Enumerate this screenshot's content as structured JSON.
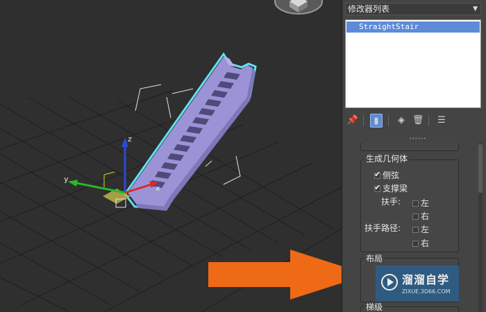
{
  "panel": {
    "modifier_dropdown": "修改器列表",
    "stack_items": [
      "StraightStair"
    ],
    "scroll_position": 0.05
  },
  "geometry_group": {
    "title": "生成几何体",
    "stringers": {
      "label": "侧弦",
      "checked": true
    },
    "carriage": {
      "label": "支撑梁",
      "checked": true
    },
    "handrail": {
      "label": "扶手:",
      "left": "左",
      "right": "右",
      "left_checked": false,
      "right_checked": false
    },
    "rail_path": {
      "label": "扶手路径:",
      "left": "左",
      "right": "右",
      "left_checked": false,
      "right_checked": false
    }
  },
  "layout_group": {
    "title": "布局"
  },
  "steps_group": {
    "title": "梯级"
  },
  "viewport": {
    "axis_x": "x",
    "axis_y": "y",
    "axis_z": "z",
    "arrow_color": "#ee6a16",
    "stair_color": "#9b93d6",
    "selection_color": "#5ee3f3"
  },
  "watermark": {
    "title": "溜溜自学",
    "url": "ZIXUE.3D66.COM"
  }
}
